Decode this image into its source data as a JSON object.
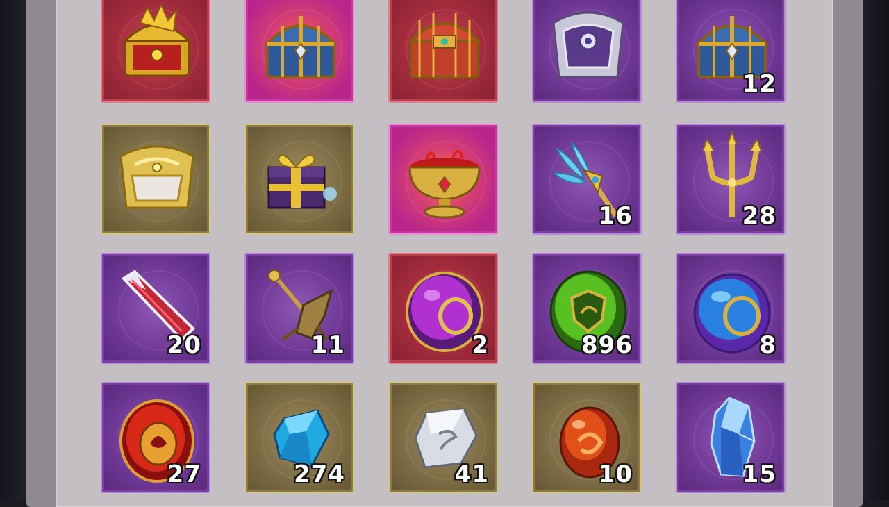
{
  "inventory": {
    "rows": [
      [
        {
          "name": "dragon-chest-icon",
          "rarity": "red",
          "qty": ""
        },
        {
          "name": "sapphire-chest-icon",
          "rarity": "pink",
          "qty": ""
        },
        {
          "name": "crimson-chest-icon",
          "rarity": "red",
          "qty": ""
        },
        {
          "name": "silver-chest-icon",
          "rarity": "purple",
          "qty": ""
        },
        {
          "name": "sapphire-chest-icon",
          "rarity": "purple",
          "qty": "12"
        }
      ],
      [
        {
          "name": "golden-chest-icon",
          "rarity": "gold",
          "qty": ""
        },
        {
          "name": "gift-box-icon",
          "rarity": "gold",
          "qty": ""
        },
        {
          "name": "chalice-icon",
          "rarity": "pink",
          "qty": ""
        },
        {
          "name": "feather-staff-icon",
          "rarity": "purple",
          "qty": "16"
        },
        {
          "name": "trident-icon",
          "rarity": "purple",
          "qty": "28"
        }
      ],
      [
        {
          "name": "crystal-shard-icon",
          "rarity": "purple",
          "qty": "20"
        },
        {
          "name": "broken-weapon-icon",
          "rarity": "purple",
          "qty": "11"
        },
        {
          "name": "purple-orb-icon",
          "rarity": "red",
          "qty": "2"
        },
        {
          "name": "green-orb-icon",
          "rarity": "purple",
          "qty": "896"
        },
        {
          "name": "blue-orb-icon",
          "rarity": "purple",
          "qty": "8"
        }
      ],
      [
        {
          "name": "red-orb-icon",
          "rarity": "purple",
          "qty": "27"
        },
        {
          "name": "blue-gem-icon",
          "rarity": "gold",
          "qty": "274"
        },
        {
          "name": "silver-stone-icon",
          "rarity": "gold",
          "qty": "41"
        },
        {
          "name": "fire-egg-icon",
          "rarity": "gold",
          "qty": "10"
        },
        {
          "name": "ice-crystal-icon",
          "rarity": "purple",
          "qty": "15"
        }
      ]
    ]
  },
  "colors": {
    "red": "#b8404e",
    "pink": "#c23aa0",
    "purple": "#7a3ea0",
    "gold": "#8c7a4a"
  }
}
